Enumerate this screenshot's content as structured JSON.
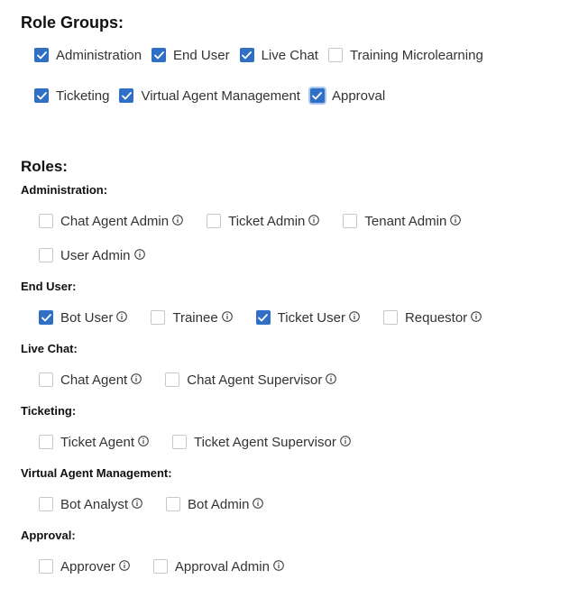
{
  "role_groups": {
    "title": "Role Groups:",
    "rows": [
      [
        {
          "label": "Administration",
          "checked": true
        },
        {
          "label": "End User",
          "checked": true
        },
        {
          "label": "Live Chat",
          "checked": true
        },
        {
          "label": "Training Microlearning",
          "checked": false
        }
      ],
      [
        {
          "label": "Ticketing",
          "checked": true
        },
        {
          "label": "Virtual Agent Management",
          "checked": true
        },
        {
          "label": "Approval",
          "checked": true
        }
      ]
    ]
  },
  "roles": {
    "title": "Roles:",
    "sections": [
      {
        "label": "Administration:",
        "rows": [
          [
            {
              "label": "Chat Agent Admin",
              "checked": false
            },
            {
              "label": "Ticket Admin",
              "checked": false
            },
            {
              "label": "Tenant Admin",
              "checked": false
            }
          ],
          [
            {
              "label": "User Admin",
              "checked": false
            }
          ]
        ]
      },
      {
        "label": "End User:",
        "rows": [
          [
            {
              "label": "Bot User",
              "checked": true
            },
            {
              "label": "Trainee",
              "checked": false
            },
            {
              "label": "Ticket User",
              "checked": true
            },
            {
              "label": "Requestor",
              "checked": false
            }
          ]
        ]
      },
      {
        "label": "Live Chat:",
        "rows": [
          [
            {
              "label": "Chat Agent",
              "checked": false
            },
            {
              "label": "Chat Agent Supervisor",
              "checked": false
            }
          ]
        ]
      },
      {
        "label": "Ticketing:",
        "rows": [
          [
            {
              "label": "Ticket Agent",
              "checked": false
            },
            {
              "label": "Ticket Agent Supervisor",
              "checked": false
            }
          ]
        ]
      },
      {
        "label": "Virtual Agent Management:",
        "rows": [
          [
            {
              "label": "Bot Analyst",
              "checked": false
            },
            {
              "label": "Bot Admin",
              "checked": false
            }
          ]
        ]
      },
      {
        "label": "Approval:",
        "rows": [
          [
            {
              "label": "Approver",
              "checked": false
            },
            {
              "label": "Approval Admin",
              "checked": false
            }
          ]
        ]
      }
    ]
  },
  "colors": {
    "accent": "#2f6fc4",
    "text": "#333333",
    "heading": "#111111",
    "checkbox_border": "#c8c8c8"
  },
  "icons": {
    "check": "check-icon",
    "info": "info-icon"
  }
}
